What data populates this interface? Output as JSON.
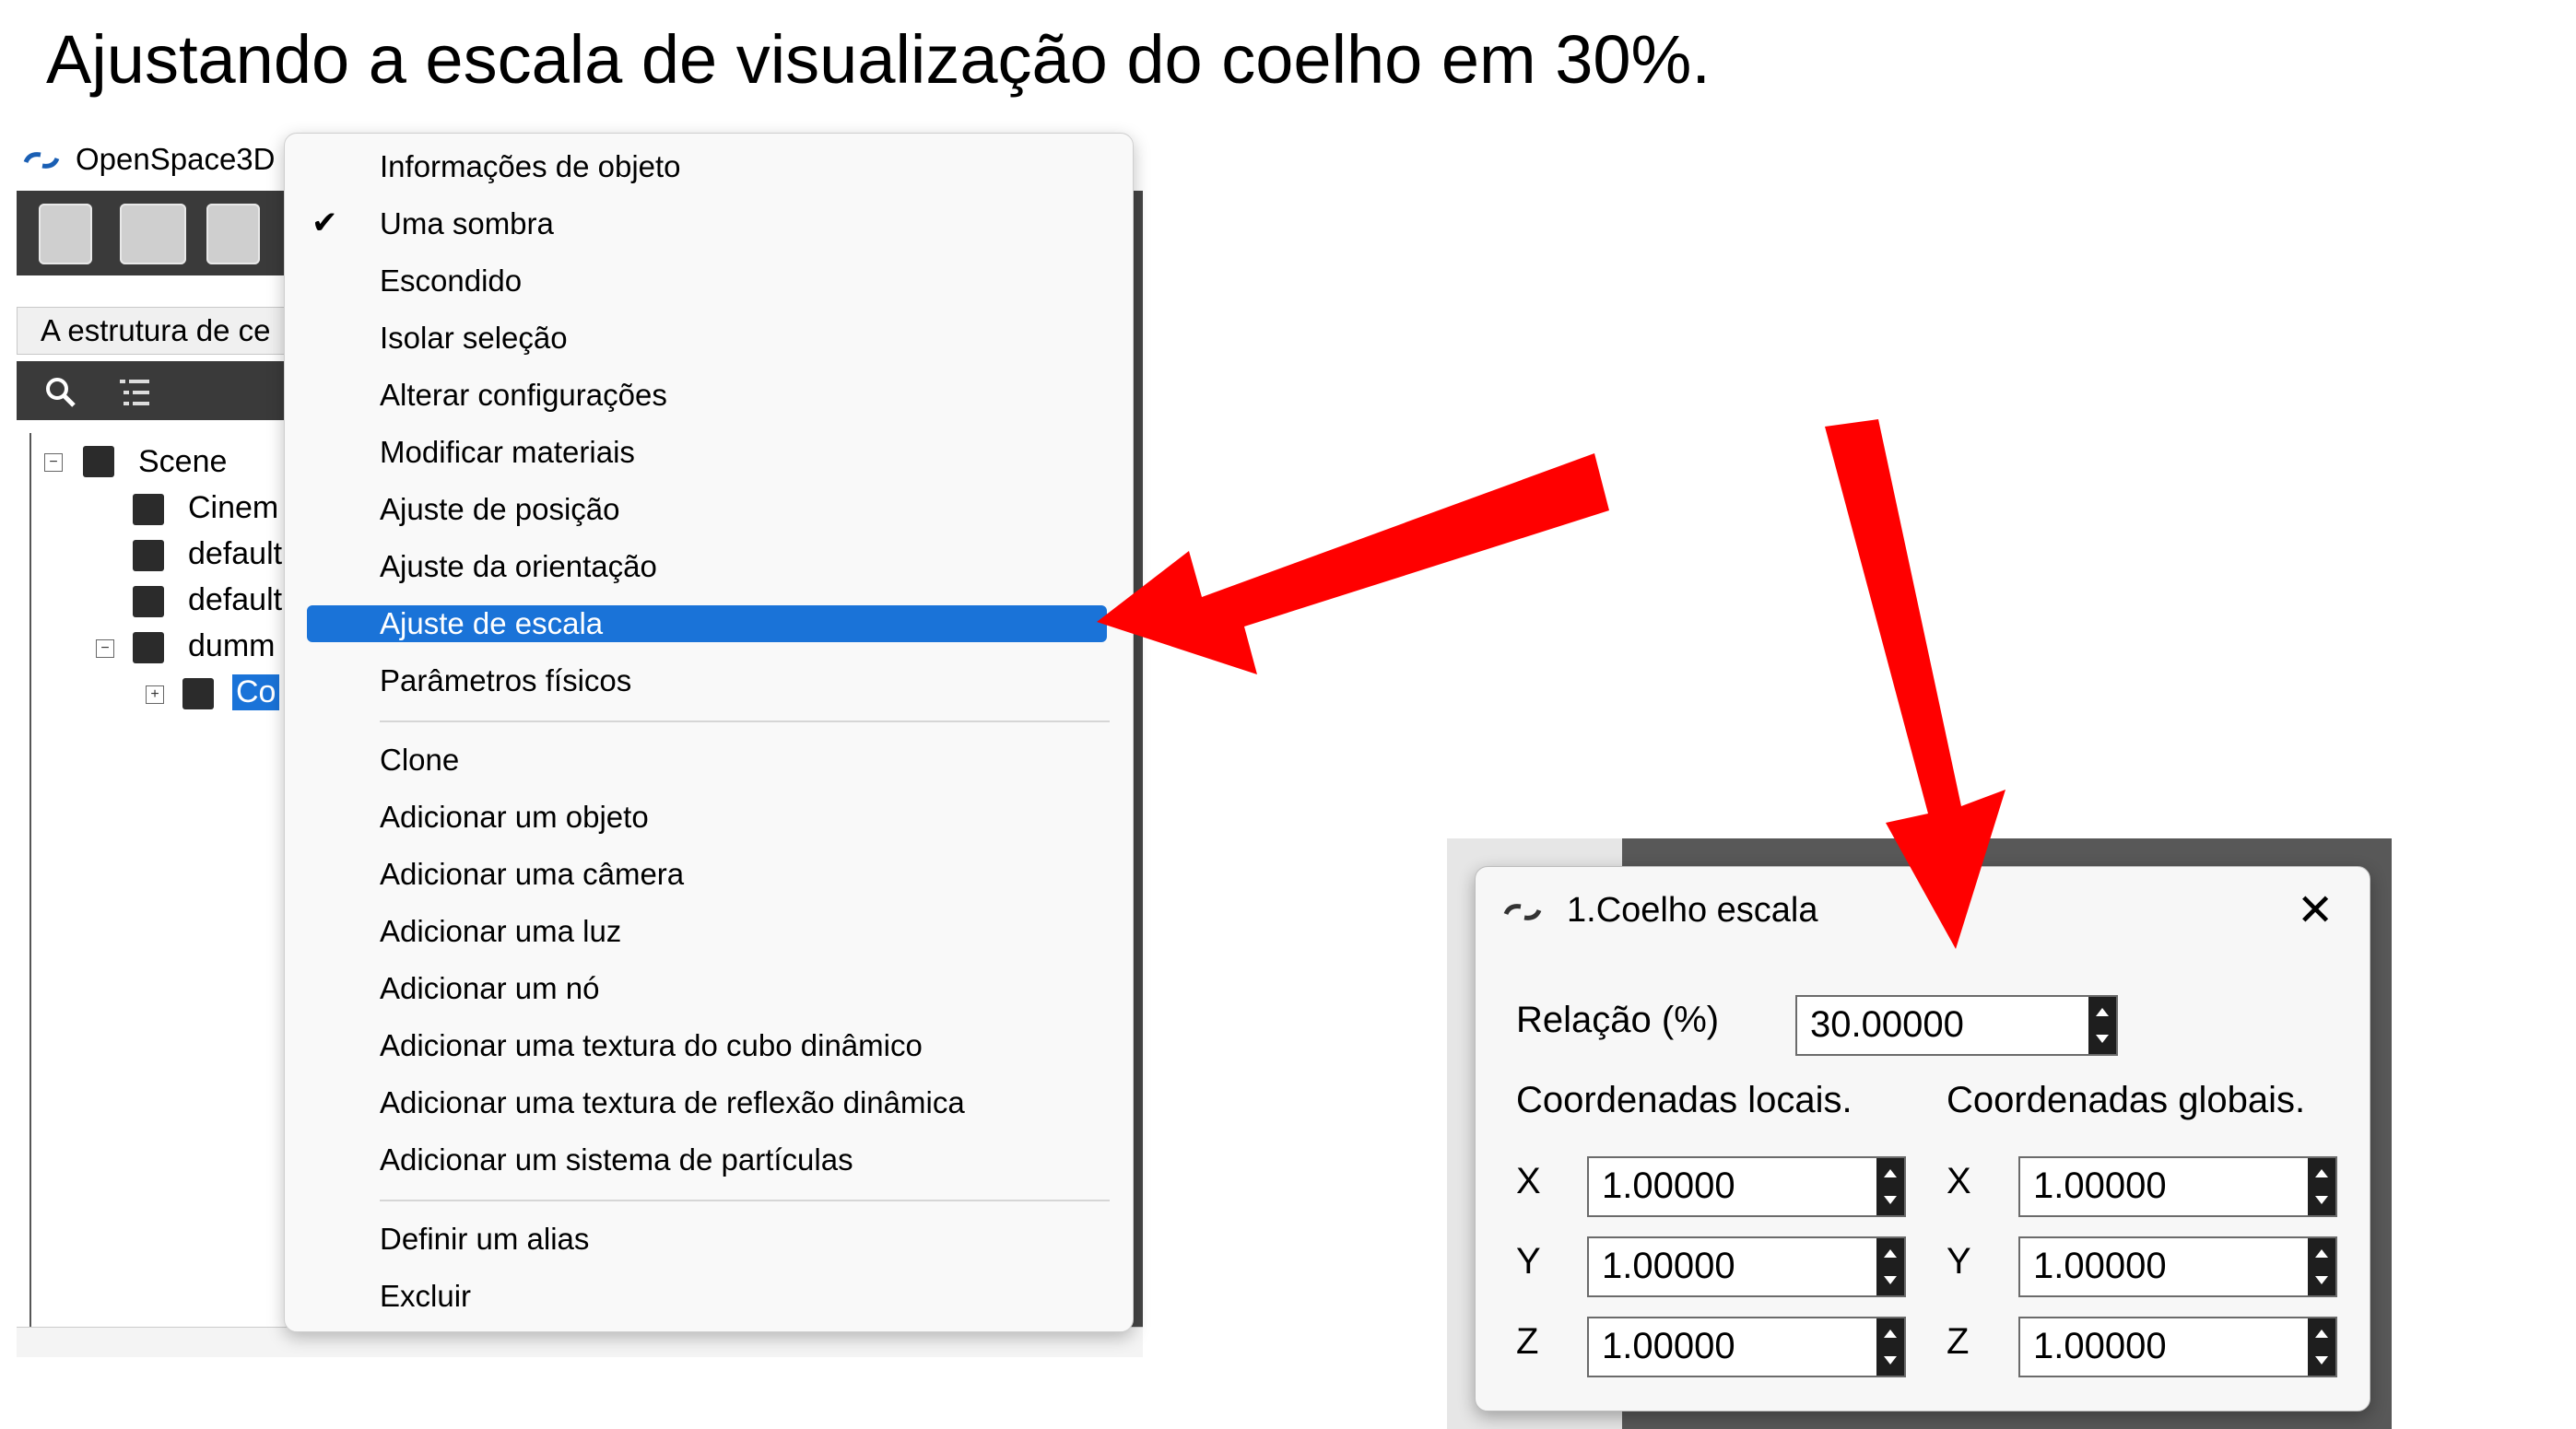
{
  "slide": {
    "title": "Ajustando a escala de visualização do coelho em 30%."
  },
  "app": {
    "title": "OpenSpace3D I",
    "panel_tab": "A estrutura de ce",
    "tree": {
      "root": "Scene",
      "items": [
        "Cinem",
        "default",
        "default",
        "dumm",
        "Co"
      ]
    }
  },
  "context_menu": {
    "checked_item": "Uma sombra",
    "groups": [
      [
        "Informações de objeto",
        "Uma sombra",
        "Escondido",
        "Isolar seleção",
        "Alterar configurações",
        "Modificar materiais",
        "Ajuste de posição",
        "Ajuste da orientação",
        "Ajuste de escala",
        "Parâmetros físicos"
      ],
      [
        "Clone",
        "Adicionar um objeto",
        "Adicionar uma câmera",
        "Adicionar uma luz",
        "Adicionar um nó",
        "Adicionar uma textura do cubo dinâmico",
        "Adicionar uma textura de reflexão dinâmica",
        "Adicionar um sistema de partículas"
      ],
      [
        "Definir um alias",
        "Excluir"
      ]
    ],
    "highlighted": "Ajuste de escala"
  },
  "dialog": {
    "title": "1.Coelho escala",
    "ratio_label": "Relação (%)",
    "ratio_value": "30.00000",
    "local_header": "Coordenadas locais.",
    "global_header": "Coordenadas globais.",
    "axes": [
      "X",
      "Y",
      "Z"
    ],
    "local_values": [
      "1.00000",
      "1.00000",
      "1.00000"
    ],
    "global_values": [
      "1.00000",
      "1.00000",
      "1.00000"
    ]
  },
  "colors": {
    "arrow": "#ff0000",
    "highlight": "#1a73d8"
  }
}
